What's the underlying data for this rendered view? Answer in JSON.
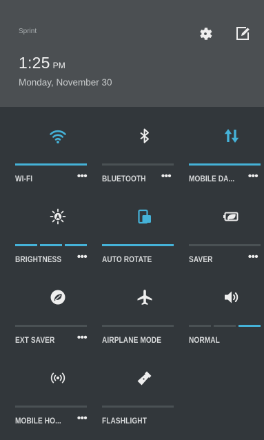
{
  "status": {
    "carrier": "Sprint",
    "time": "1:25",
    "ampm": "PM",
    "date": "Monday, November 30"
  },
  "header": {
    "settings_icon": "gear-icon",
    "edit_icon": "edit-icon"
  },
  "colors": {
    "accent": "#45b2d8",
    "panel": "#32373b",
    "header": "#4b4f52",
    "inactive_bar": "#4a5154",
    "icon": "#eeeeee"
  },
  "tiles": [
    {
      "label": "WI-FI",
      "more": "•••",
      "icon": "wifi-icon",
      "active": true
    },
    {
      "label": "BLUETOOTH",
      "more": "•••",
      "icon": "bluetooth-icon",
      "active": false
    },
    {
      "label": "MOBILE DA...",
      "more": "•••",
      "icon": "mobile-data-icon",
      "active": true
    },
    {
      "label": "BRIGHTNESS",
      "more": "•••",
      "icon": "brightness-icon",
      "active": true,
      "level": "3 of 3"
    },
    {
      "label": "AUTO ROTATE",
      "icon": "auto-rotate-icon",
      "active": true
    },
    {
      "label": "SAVER",
      "more": "•••",
      "icon": "battery-saver-icon",
      "active": false
    },
    {
      "label": "EXT SAVER",
      "more": "•••",
      "icon": "extended-saver-icon",
      "active": false
    },
    {
      "label": "AIRPLANE MODE",
      "icon": "airplane-icon",
      "active": false
    },
    {
      "label": "NORMAL",
      "icon": "volume-icon",
      "active": false,
      "level": "3 of 3"
    },
    {
      "label": "MOBILE HO...",
      "more": "•••",
      "icon": "hotspot-icon",
      "active": false
    },
    {
      "label": "FLASHLIGHT",
      "icon": "flashlight-icon",
      "active": false
    }
  ]
}
